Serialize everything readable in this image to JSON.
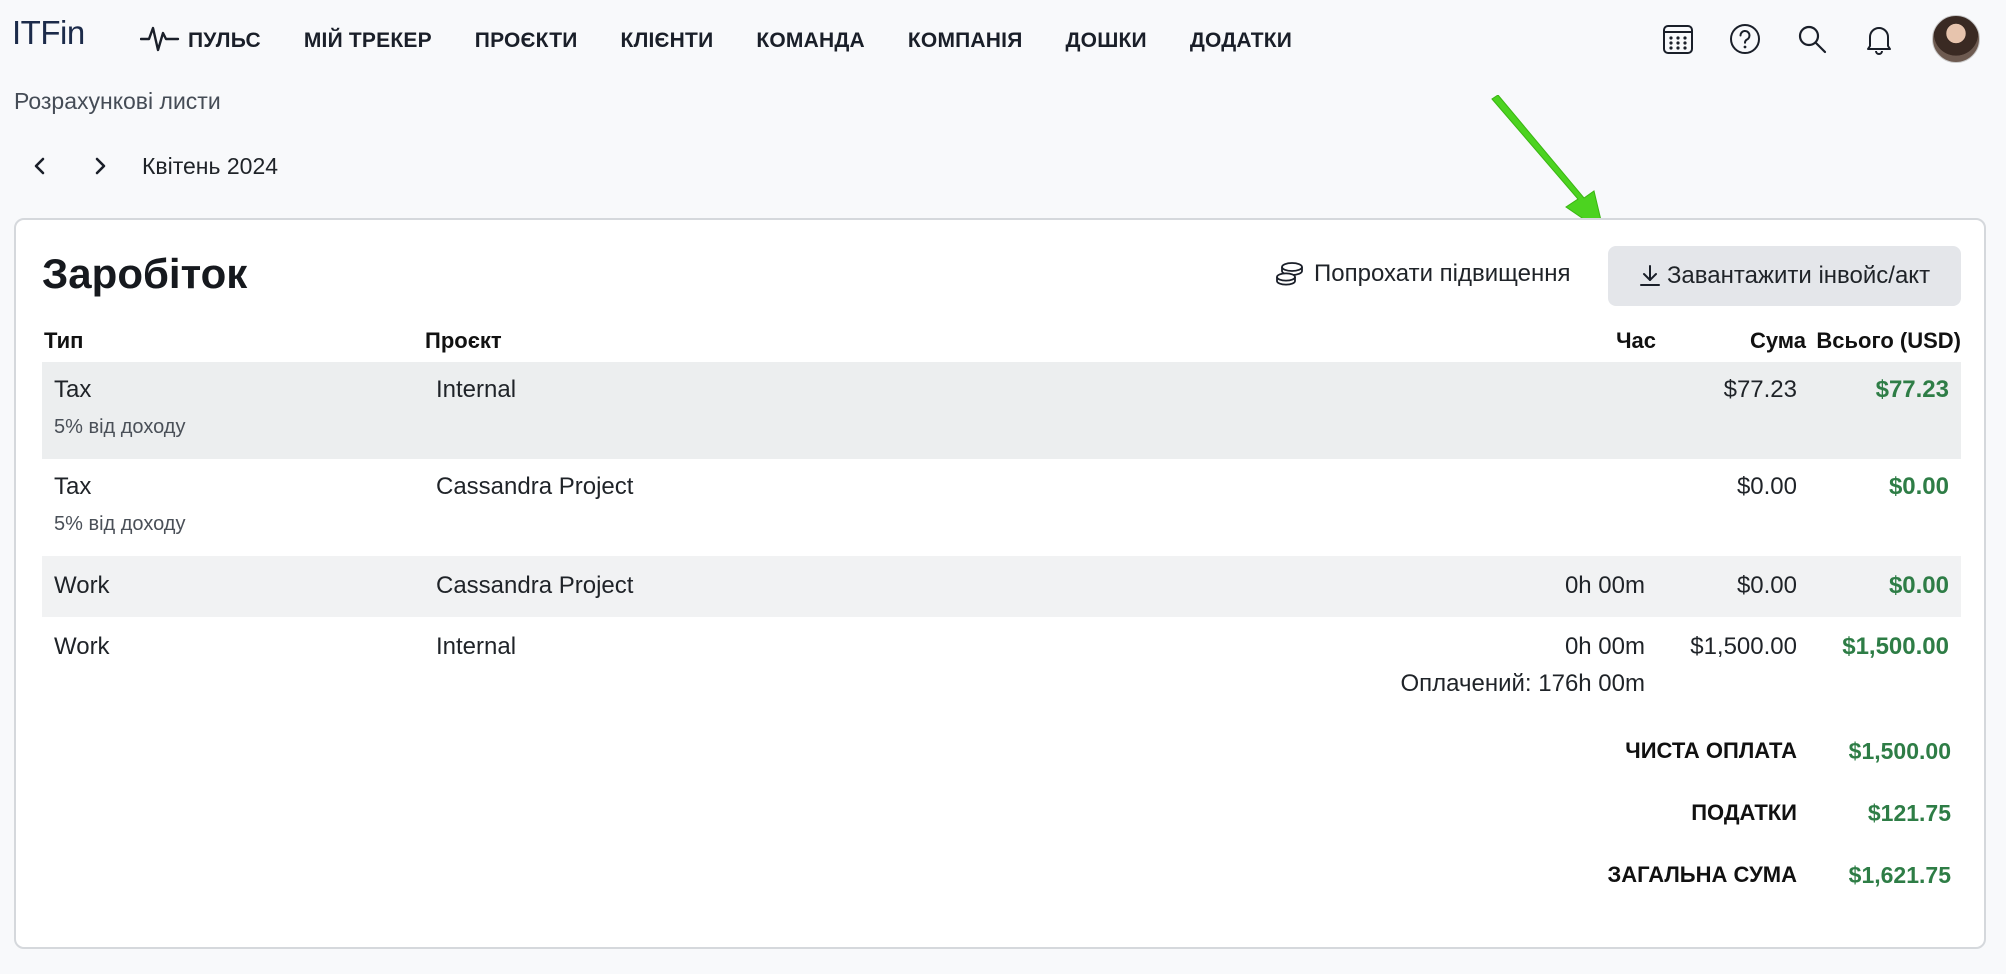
{
  "app": {
    "logo": "ITFin"
  },
  "nav": {
    "items": [
      {
        "label": "ПУЛЬС",
        "icon": "pulse-icon"
      },
      {
        "label": "МІЙ ТРЕКЕР"
      },
      {
        "label": "ПРОЄКТИ"
      },
      {
        "label": "КЛІЄНТИ"
      },
      {
        "label": "КОМАНДА"
      },
      {
        "label": "КОМПАНІЯ"
      },
      {
        "label": "ДОШКИ"
      },
      {
        "label": "ДОДАТКИ"
      }
    ],
    "icons": [
      "calendar-icon",
      "help-icon",
      "search-icon",
      "bell-icon"
    ]
  },
  "page": {
    "title": "Розрахункові листи",
    "month": "Квітень 2024"
  },
  "card": {
    "title": "Заробіток",
    "raise_label": "Попрохати підвищення",
    "download_label": "Завантажити інвойс/акт"
  },
  "table": {
    "headers": {
      "type": "Тип",
      "project": "Проєкт",
      "time": "Час",
      "sum": "Сума",
      "total": "Всього (USD)"
    },
    "rows": [
      {
        "type": "Tax",
        "note": "5% від доходу",
        "project": "Internal",
        "time": "",
        "paid": "",
        "sum": "$77.23",
        "total": "$77.23"
      },
      {
        "type": "Tax",
        "note": "5% від доходу",
        "project": "Cassandra Project",
        "time": "",
        "paid": "",
        "sum": "$0.00",
        "total": "$0.00"
      },
      {
        "type": "Work",
        "note": "",
        "project": "Cassandra Project",
        "time": "0h 00m",
        "paid": "",
        "sum": "$0.00",
        "total": "$0.00"
      },
      {
        "type": "Work",
        "note": "",
        "project": "Internal",
        "time": "0h 00m",
        "paid": "Оплачений: 176h 00m",
        "sum": "$1,500.00",
        "total": "$1,500.00"
      }
    ]
  },
  "totals": {
    "net_label": "ЧИСТА ОПЛАТА",
    "net_value": "$1,500.00",
    "tax_label": "ПОДАТКИ",
    "tax_value": "$121.75",
    "grand_label": "ЗАГАЛЬНА СУМА",
    "grand_value": "$1,621.75"
  },
  "colors": {
    "accent_green": "#2e7d46",
    "arrow_green": "#4cd320",
    "button_bg": "#e4e6ea"
  }
}
